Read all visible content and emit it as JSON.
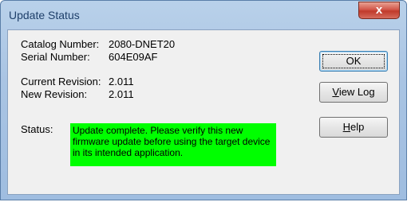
{
  "window": {
    "title": "Update Status",
    "close_glyph": "x"
  },
  "fields": {
    "catalog_label": "Catalog Number:",
    "catalog_value": "2080-DNET20",
    "serial_label": "Serial Number:",
    "serial_value": "604E09AF",
    "current_label": "Current Revision:",
    "current_value": "2.011",
    "new_label": "New Revision:",
    "new_value": "2.011",
    "status_label": "Status:",
    "status_message": "Update complete. Please verify this new firmware update before using the target device in its intended application."
  },
  "buttons": {
    "ok": "OK",
    "view_log_first": "V",
    "view_log_rest": "iew Log",
    "help_first": "H",
    "help_rest": "elp"
  },
  "colors": {
    "status_highlight": "#00ff00",
    "close_button": "#c03a2b"
  }
}
